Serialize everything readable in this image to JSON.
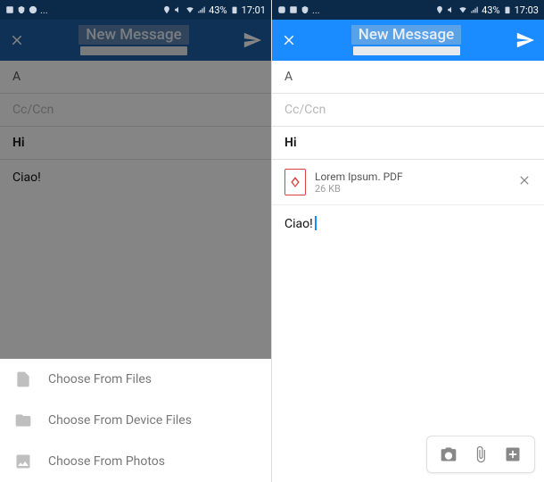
{
  "status": {
    "ellipsis": "...",
    "battery": "43%",
    "time_left": "17:01",
    "time_right": "17:03"
  },
  "header": {
    "title": "New Message"
  },
  "compose": {
    "to_label": "A",
    "cc_label": "Cc/Ccn",
    "subject": "Hi",
    "body": "Ciao!"
  },
  "attachment": {
    "name": "Lorem Ipsum. PDF",
    "size": "26 KB"
  },
  "sheet": {
    "files": "Choose From Files",
    "device": "Choose From Device Files",
    "photos": "Choose From Photos"
  }
}
